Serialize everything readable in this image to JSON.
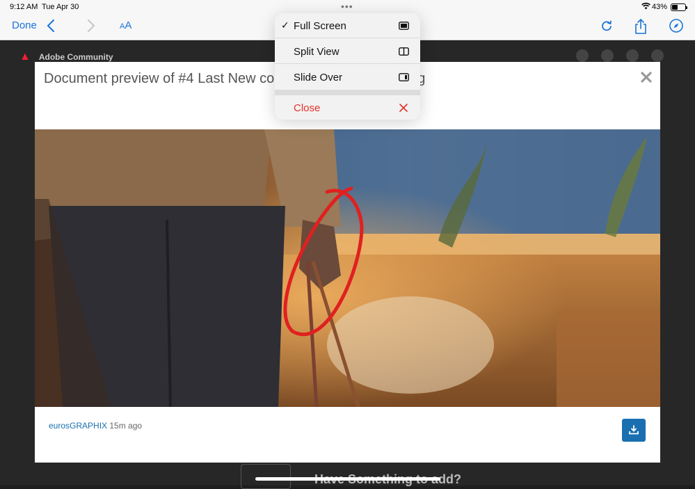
{
  "status_bar": {
    "time": "9:12 AM",
    "date": "Tue Apr 30",
    "battery_percent": "43%",
    "battery_level": 0.43
  },
  "toolbar": {
    "done_label": "Done",
    "text_size_label_small": "A",
    "text_size_label_large": "A"
  },
  "background_page": {
    "site_name": "Adobe Community",
    "bottom_text": "Have Something to add?"
  },
  "modal": {
    "title": "Document preview of #4 Last New co   pt. at night @300dpi.jpg",
    "author": "eurosGRAPHIX",
    "time_ago": "15m ago"
  },
  "multitask_menu": {
    "items": [
      {
        "label": "Full Screen",
        "checked": true,
        "icon": "full-screen-icon"
      },
      {
        "label": "Split View",
        "checked": false,
        "icon": "split-view-icon"
      },
      {
        "label": "Slide Over",
        "checked": false,
        "icon": "slide-over-icon"
      }
    ],
    "close_label": "Close",
    "check_glyph": "✓"
  },
  "colors": {
    "accent": "#1a73d9",
    "download_button": "#1a6fb0",
    "close_red": "#e5302a"
  }
}
